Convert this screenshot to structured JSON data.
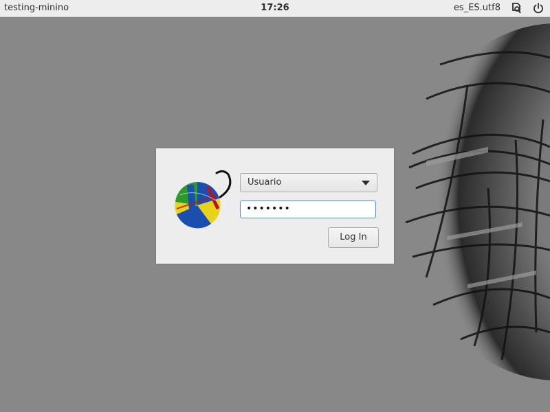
{
  "topbar": {
    "hostname": "testing-minino",
    "time": "17:26",
    "locale": "es_ES.utf8",
    "icons": [
      "accessibility-icon",
      "power-icon"
    ]
  },
  "login": {
    "user_selected": "Usuario",
    "password_mask": "•••••••",
    "login_label": "Log In",
    "logo": "minino-yarn-logo"
  },
  "colors": {
    "background": "#888888",
    "panel": "#ededed",
    "focus": "#4a90d9"
  }
}
